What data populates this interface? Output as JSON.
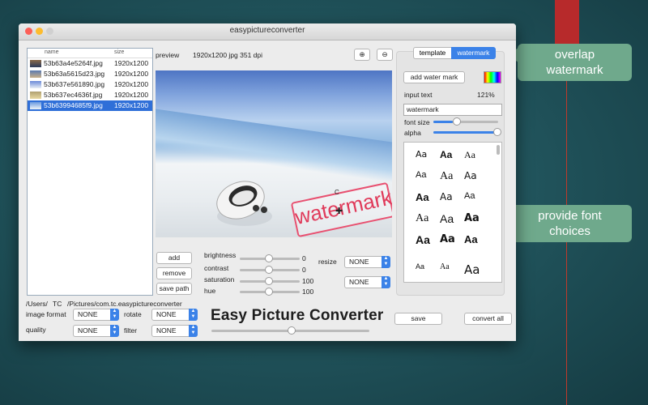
{
  "window": {
    "title": "easypictureconverter"
  },
  "files": {
    "headers": {
      "name": "name",
      "size": "size"
    },
    "rows": [
      {
        "name": "53b63a4e5264f.jpg",
        "size": "1920x1200"
      },
      {
        "name": "53b63a5615d23.jpg",
        "size": "1920x1200"
      },
      {
        "name": "53b637e561890.jpg",
        "size": "1920x1200"
      },
      {
        "name": "53b637ec4636f.jpg",
        "size": "1920x1200"
      },
      {
        "name": "53b63994685f9.jpg",
        "size": "1920x1200"
      }
    ]
  },
  "preview": {
    "label": "preview",
    "info": "1920x1200 jpg 351 dpi",
    "watermark_text": "watermark",
    "cursor_char": "C"
  },
  "buttons": {
    "add": "add",
    "remove": "remove",
    "save_path": "save path",
    "save": "save",
    "convert_all": "convert all",
    "add_water_mark": "add water mark"
  },
  "adjustments": {
    "brightness": {
      "label": "brightness",
      "value": "0",
      "fraction": 0.5
    },
    "contrast": {
      "label": "contrast",
      "value": "0",
      "fraction": 0.5
    },
    "saturation": {
      "label": "saturation",
      "value": "100",
      "fraction": 0.5
    },
    "hue": {
      "label": "hue",
      "value": "100",
      "fraction": 0.5
    }
  },
  "resize": {
    "label": "resize",
    "value": "NONE",
    "value2": "NONE"
  },
  "path": {
    "prefix": "/Users/",
    "user": "TC",
    "suffix": "/Pictures/com.tc.easypictureconverter"
  },
  "format": {
    "image_format_label": "image format",
    "image_format_value": "NONE",
    "quality_label": "quality",
    "quality_value": "NONE",
    "rotate_label": "rotate",
    "rotate_value": "NONE",
    "filter_label": "filter",
    "filter_value": "NONE"
  },
  "app_title": "Easy Picture Converter",
  "watermark_panel": {
    "tab_template": "template",
    "tab_watermark": "watermark",
    "input_label": "input text",
    "zoom": "121%",
    "text_value": "watermark",
    "font_size_label": "font size",
    "alpha_label": "alpha",
    "font_size_fraction": 0.3,
    "alpha_fraction": 0.97,
    "font_samples": [
      "Aa",
      "Aa",
      "Aa",
      "Aa",
      "Aa",
      "Aa",
      "Aa",
      "Aa",
      "Aa",
      "Aa",
      "Aa",
      "Aa",
      "Aa",
      "Aa",
      "Aa",
      "Aa",
      "Aa",
      "Aa"
    ]
  },
  "callouts": {
    "watermark": "overlap\nwatermark",
    "fonts": "provide font\nchoices"
  },
  "colors": {
    "accent": "#3b82e8",
    "selection": "#2f6fd8",
    "callout": "#6fa98c",
    "watermark": "#e03a5a"
  },
  "icons": {
    "zoom_in": "zoom-in-icon",
    "zoom_out": "zoom-out-icon",
    "color_picker": "color-swatch-icon"
  }
}
